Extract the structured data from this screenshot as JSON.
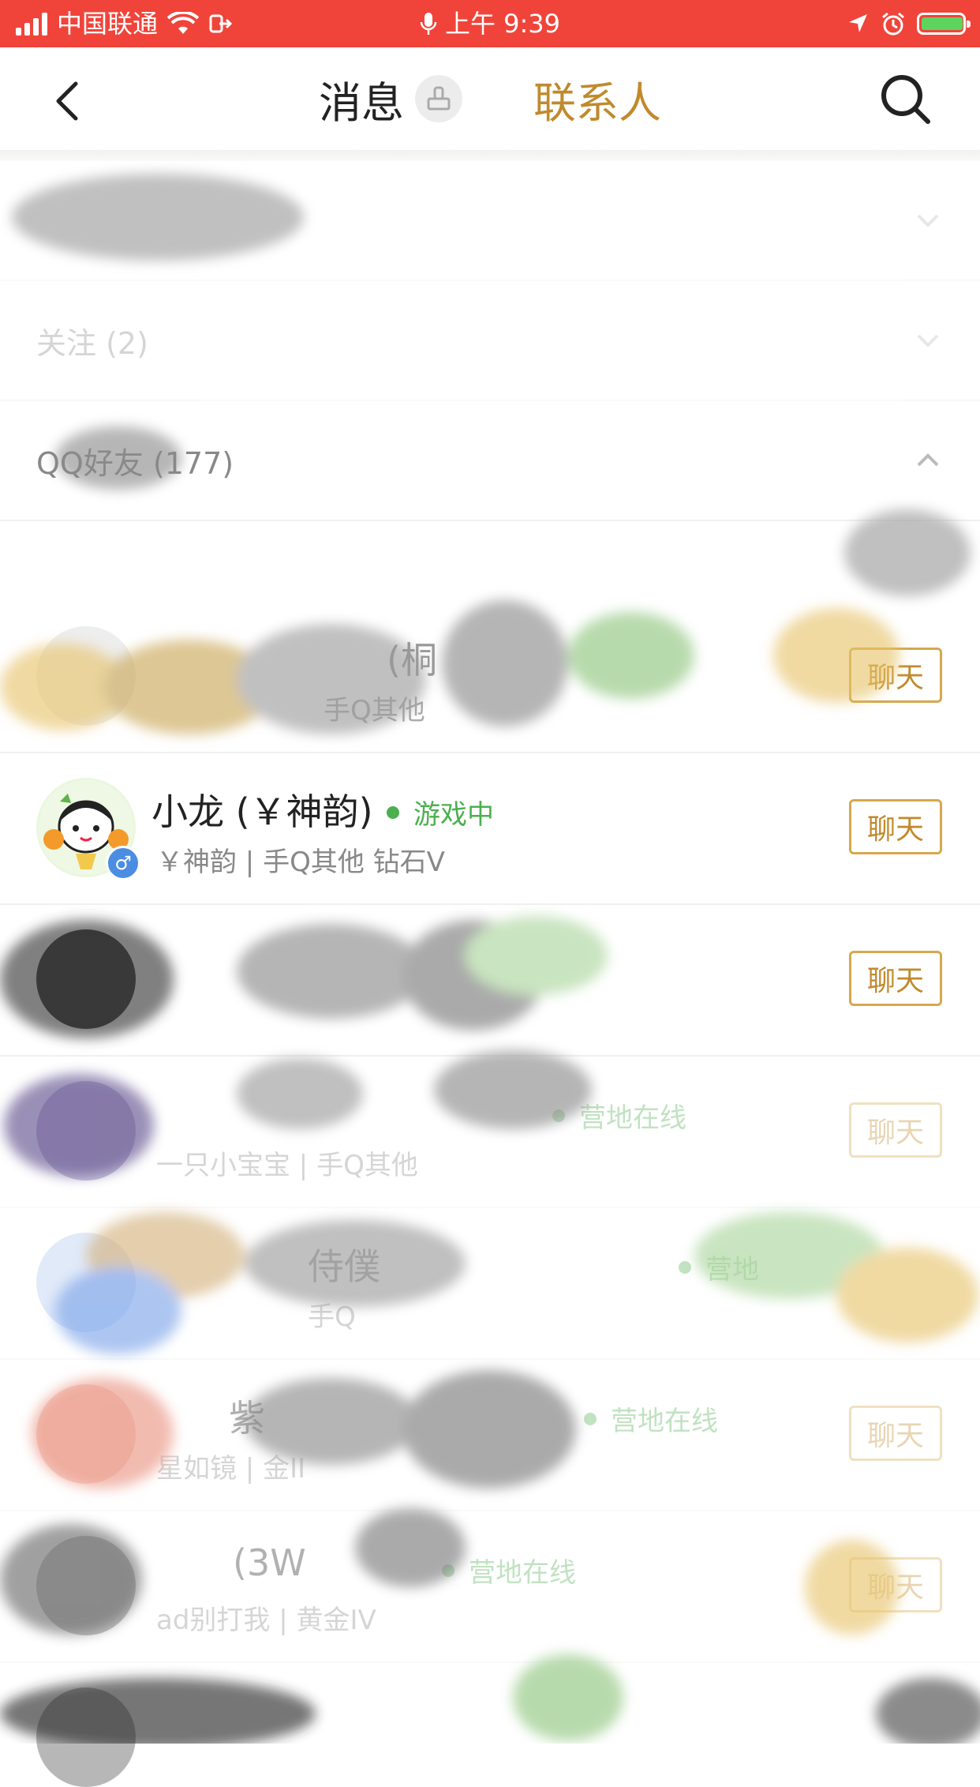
{
  "status_bar": {
    "carrier": "中国联通",
    "time": "上午 9:39"
  },
  "nav": {
    "tab_messages": "消息",
    "tab_contacts": "联系人"
  },
  "sections": [
    {
      "label": ""
    },
    {
      "label": "关注 (2)"
    },
    {
      "label": "QQ好友 (177)"
    }
  ],
  "contacts": [
    {
      "name": "(桐",
      "status": "",
      "sub": "手Q其他",
      "chat": "聊天"
    },
    {
      "name": "小龙 (￥神韵)",
      "status": "游戏中",
      "sub": "￥神韵 | 手Q其他 钻石V",
      "chat": "聊天"
    },
    {
      "name": "",
      "status": "",
      "sub": "",
      "chat": "聊天"
    },
    {
      "name": "",
      "status": "营地在线",
      "sub": "一只小宝宝 | 手Q其他",
      "chat": "聊天"
    },
    {
      "name": "侍僕",
      "status": "营地",
      "sub": "手Q",
      "chat": ""
    },
    {
      "name": "紫",
      "status": "营地在线",
      "sub": "星如镜 | 金II",
      "chat": "聊天"
    },
    {
      "name": "(3W",
      "status": "营地在线",
      "sub": "ad别打我 | 黄金IV",
      "chat": "聊天"
    }
  ],
  "colors": {
    "status_bar_bg": "#f0443a",
    "accent_gold": "#c08a2c",
    "online_green": "#4caf50"
  }
}
